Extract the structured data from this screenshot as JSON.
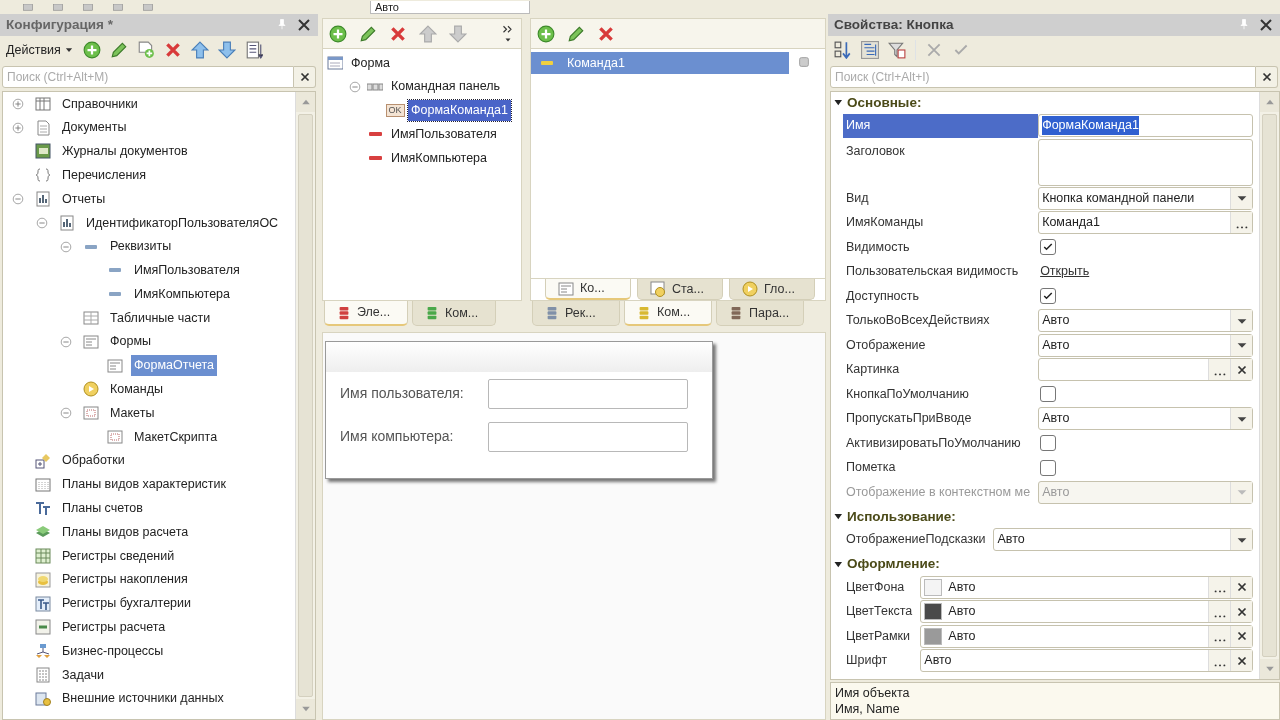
{
  "top_toolbar": {
    "field_value": "Авто"
  },
  "configuration": {
    "title": "Конфигурация *",
    "actions_label": "Действия",
    "search_placeholder": "Поиск (Ctrl+Alt+M)",
    "tree": [
      {
        "label": "Справочники",
        "kind": "catalog",
        "expanded": false,
        "selected": false
      },
      {
        "label": "Документы",
        "kind": "document",
        "expanded": false,
        "selected": false
      },
      {
        "label": "Журналы документов",
        "kind": "journal",
        "selected": false
      },
      {
        "label": "Перечисления",
        "kind": "enum",
        "selected": false
      },
      {
        "label": "Отчеты",
        "kind": "report",
        "expanded": true,
        "selected": false,
        "children": [
          {
            "label": "ИдентификаторПользователяОС",
            "kind": "report",
            "expanded": true,
            "selected": false,
            "children": [
              {
                "label": "Реквизиты",
                "kind": "attribute",
                "expanded": true,
                "selected": false,
                "children": [
                  {
                    "label": "ИмяПользователя",
                    "kind": "attribute",
                    "selected": false
                  },
                  {
                    "label": "ИмяКомпьютера",
                    "kind": "attribute",
                    "selected": false
                  }
                ]
              },
              {
                "label": "Табличные части",
                "kind": "tabular",
                "selected": false
              },
              {
                "label": "Формы",
                "kind": "form",
                "expanded": true,
                "selected": false,
                "children": [
                  {
                    "label": "ФормаОтчета",
                    "kind": "form",
                    "selected": true
                  }
                ]
              },
              {
                "label": "Команды",
                "kind": "commands",
                "selected": false
              },
              {
                "label": "Макеты",
                "kind": "layout",
                "expanded": true,
                "selected": false,
                "children": [
                  {
                    "label": "МакетСкрипта",
                    "kind": "layout",
                    "selected": false
                  }
                ]
              }
            ]
          }
        ]
      },
      {
        "label": "Обработки",
        "kind": "processing",
        "selected": false
      },
      {
        "label": "Планы видов характеристик",
        "kind": "grid",
        "selected": false
      },
      {
        "label": "Планы счетов",
        "kind": "accounts",
        "selected": false
      },
      {
        "label": "Планы видов расчета",
        "kind": "layers",
        "selected": false
      },
      {
        "label": "Регистры сведений",
        "kind": "info_register",
        "selected": false
      },
      {
        "label": "Регистры накопления",
        "kind": "coins",
        "selected": false
      },
      {
        "label": "Регистры бухгалтерии",
        "kind": "accounts_box",
        "selected": false
      },
      {
        "label": "Регистры расчета",
        "kind": "calc_register",
        "selected": false
      },
      {
        "label": "Бизнес-процессы",
        "kind": "flow",
        "selected": false
      },
      {
        "label": "Задачи",
        "kind": "task",
        "selected": false
      },
      {
        "label": "Внешние источники данных",
        "kind": "database",
        "selected": false
      }
    ]
  },
  "form_editor": {
    "elements": [
      {
        "label": "Форма",
        "kind": "form_root",
        "selected": false,
        "children": [
          {
            "label": "Командная панель",
            "kind": "command_bar",
            "expanded": true,
            "selected": false,
            "children": [
              {
                "label": "ФормаКоманда1",
                "kind": "button",
                "badge": "OK",
                "selected": true
              }
            ]
          },
          {
            "label": "ИмяПользователя",
            "kind": "field",
            "selected": false
          },
          {
            "label": "ИмяКомпьютера",
            "kind": "field",
            "selected": false
          }
        ]
      }
    ],
    "element_tabs": [
      {
        "label": "Эле...",
        "color": "#d04040",
        "selected": true
      },
      {
        "label": "Ком...",
        "color": "#4aa84a",
        "selected": false
      }
    ],
    "commands": [
      {
        "label": "Команда1",
        "selected": true
      }
    ],
    "command_subtabs": [
      {
        "label": "Ко...",
        "kind": "form",
        "selected": true
      },
      {
        "label": "Ста...",
        "kind": "standard",
        "selected": false
      },
      {
        "label": "Гло...",
        "kind": "global",
        "selected": false
      }
    ],
    "data_tabs": [
      {
        "label": "Рек...",
        "color": "#8090a8",
        "selected": false
      },
      {
        "label": "Ком...",
        "color": "#d8b830",
        "selected": true
      },
      {
        "label": "Пара...",
        "color": "#806858",
        "selected": false
      }
    ],
    "preview": {
      "fields": [
        {
          "label": "Имя пользователя:"
        },
        {
          "label": "Имя компьютера:"
        }
      ]
    }
  },
  "properties": {
    "title": "Свойства: Кнопка",
    "search_placeholder": "Поиск (Ctrl+Alt+I)",
    "groups": [
      {
        "title": "Основные:",
        "expanded": true,
        "rows": [
          {
            "name": "Имя",
            "kind": "text",
            "value": "ФормаКоманда1",
            "selected": true,
            "disabled": false
          },
          {
            "name": "Заголовок",
            "kind": "memo",
            "selected": false,
            "disabled": false
          },
          {
            "name": "Вид",
            "kind": "select",
            "value": "Кнопка командной панели",
            "selected": false,
            "disabled": false
          },
          {
            "name": "ИмяКоманды",
            "kind": "choice",
            "value": "Команда1",
            "selected": false,
            "disabled": false
          },
          {
            "name": "Видимость",
            "kind": "check",
            "checked": true,
            "selected": false,
            "disabled": false
          },
          {
            "name": "Пользовательская видимость",
            "kind": "link",
            "value": "Открыть",
            "selected": false,
            "disabled": false
          },
          {
            "name": "Доступность",
            "kind": "check",
            "checked": true,
            "selected": false,
            "disabled": false
          },
          {
            "name": "ТолькоВоВсехДействиях",
            "kind": "select",
            "value": "Авто",
            "selected": false,
            "disabled": false
          },
          {
            "name": "Отображение",
            "kind": "select",
            "value": "Авто",
            "selected": false,
            "disabled": false
          },
          {
            "name": "Картинка",
            "kind": "clearable",
            "selected": false,
            "disabled": false
          },
          {
            "name": "КнопкаПоУмолчанию",
            "kind": "check",
            "checked": false,
            "selected": false,
            "disabled": false
          },
          {
            "name": "ПропускатьПриВводе",
            "kind": "select",
            "value": "Авто",
            "selected": false,
            "disabled": false
          },
          {
            "name": "АктивизироватьПоУмолчанию",
            "kind": "check",
            "checked": false,
            "selected": false,
            "disabled": false
          },
          {
            "name": "Пометка",
            "kind": "check",
            "checked": false,
            "selected": false,
            "disabled": false
          },
          {
            "name": "Отображение в контекстном ме",
            "kind": "select",
            "value": "Авто",
            "selected": false,
            "disabled": true
          }
        ]
      },
      {
        "title": "Использование:",
        "expanded": true,
        "rows": [
          {
            "name": "ОтображениеПодсказки",
            "kind": "select",
            "value": "Авто",
            "selected": false,
            "disabled": false
          }
        ]
      },
      {
        "title": "Оформление:",
        "expanded": true,
        "rows": [
          {
            "name": "ЦветФона",
            "kind": "color",
            "color": "#f4f4f4",
            "value": "Авто",
            "selected": false,
            "disabled": false
          },
          {
            "name": "ЦветТекста",
            "kind": "color",
            "color": "#4a4a4a",
            "value": "Авто",
            "selected": false,
            "disabled": false
          },
          {
            "name": "ЦветРамки",
            "kind": "color",
            "color": "#9a9a9a",
            "value": "Авто",
            "selected": false,
            "disabled": false
          },
          {
            "name": "Шрифт",
            "kind": "clearable",
            "value": "Авто",
            "selected": false,
            "disabled": false
          }
        ]
      }
    ],
    "description": [
      "Имя объекта",
      "Имя, Name"
    ]
  }
}
